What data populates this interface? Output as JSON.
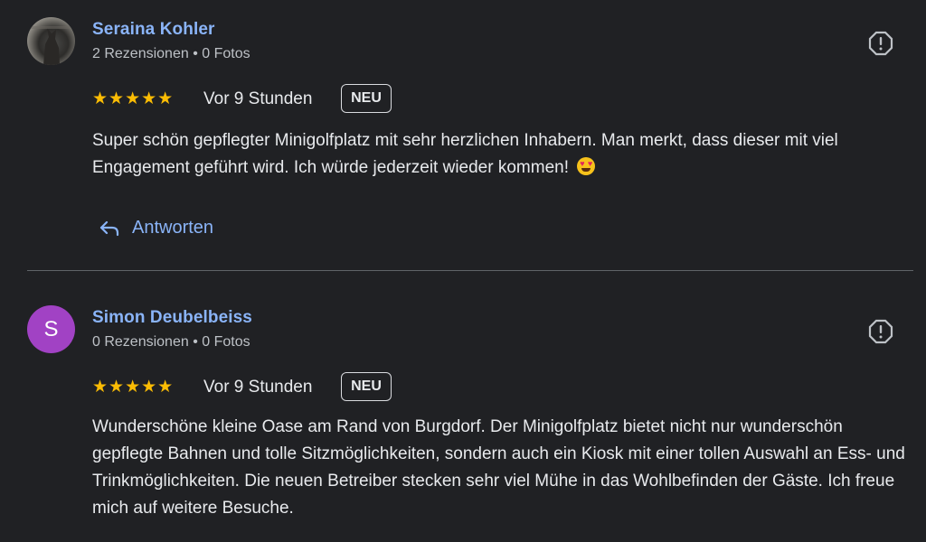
{
  "reviews": [
    {
      "author": "Seraina Kohler",
      "meta": "2 Rezensionen • 0 Fotos",
      "rating": "★★★★★",
      "time": "Vor 9 Stunden",
      "badge": "NEU",
      "text": "Super schön gepflegter Minigolfplatz mit sehr herzlichen Inhabern. Man merkt, dass dieser mit viel Engagement geführt wird. Ich würde jederzeit wieder kommen!",
      "emoji": "heart-eyes-emoji",
      "reply_label": "Antworten"
    },
    {
      "author": "Simon Deubelbeiss",
      "avatar_letter": "S",
      "meta": "0 Rezensionen • 0 Fotos",
      "rating": "★★★★★",
      "time": "Vor 9 Stunden",
      "badge": "NEU",
      "text": "Wunderschöne kleine Oase am Rand von Burgdorf. Der Minigolfplatz bietet nicht nur wunderschön gepflegte Bahnen und tolle Sitzmöglichkeiten, sondern auch ein Kiosk mit einer tollen Auswahl an Ess- und Trinkmöglichkeiten. Die neuen Betreiber stecken sehr viel Mühe in das Wohlbefinden der Gäste. Ich freue mich auf weitere Besuche."
    }
  ],
  "colors": {
    "background": "#202124",
    "link": "#8ab4f8",
    "star": "#fbbc04",
    "avatar_s": "#a142c4"
  }
}
